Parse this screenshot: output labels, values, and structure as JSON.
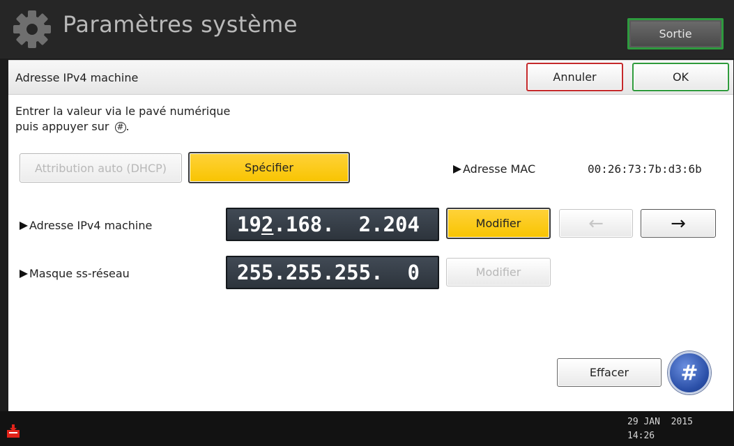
{
  "titlebar": {
    "title": "Paramètres système",
    "exit_label": "Sortie",
    "icon": "gear-icon"
  },
  "header": {
    "title": "Adresse IPv4 machine",
    "cancel_label": "Annuler",
    "ok_label": "OK"
  },
  "instructions": {
    "line1": "Entrer la valeur via le pavé numérique",
    "line2_prefix": "puis appuyer sur ",
    "line2_symbol": "#",
    "line2_suffix": "."
  },
  "mode": {
    "dhcp_label": "Attribution auto (DHCP)",
    "specify_label": "Spécifier",
    "selected": "Spécifier"
  },
  "mac": {
    "label": "Adresse MAC",
    "value": "00:26:73:7b:d3:6b"
  },
  "ipv4": {
    "label": "Adresse IPv4 machine",
    "octets": [
      "192",
      "168",
      "2",
      "204"
    ],
    "modify_label": "Modifier"
  },
  "subnet": {
    "label": "Masque ss-réseau",
    "octets": [
      "255",
      "255",
      "255",
      "0"
    ],
    "modify_label": "Modifier"
  },
  "nav": {
    "left": "←",
    "right": "→"
  },
  "actions": {
    "clear_label": "Effacer",
    "enter_symbol": "#"
  },
  "status": {
    "date": "29 JAN  2015",
    "time": "14:26"
  },
  "colors": {
    "selected_yellow": "#f8c400",
    "ok_green": "#2f9b3c",
    "cancel_red": "#c5292b",
    "field_dark": "#343b44",
    "enter_blue": "#2b50a8"
  }
}
